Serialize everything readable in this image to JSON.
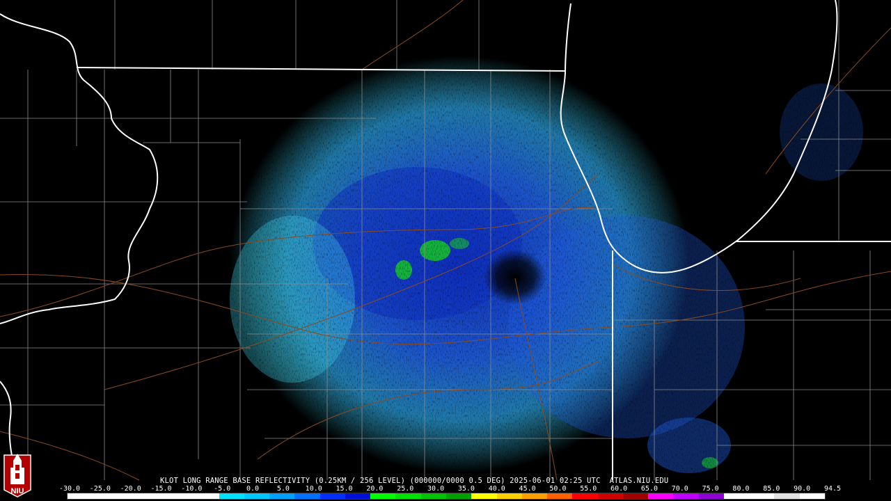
{
  "caption": "KLOT LONG RANGE BASE REFLECTIVITY (0.25KM / 256 LEVEL) (000000/0000 0.5 DEG) 2025-06-01 02:25 UTC  ATLAS.NIU.EDU",
  "logo": {
    "text": "NIU",
    "icon": "university-tower-logo-icon"
  },
  "colors": {
    "background": "#000000",
    "state_border": "#ffffff",
    "county_line": "#8a8a8a",
    "highway": "#8a4a20",
    "light_cyan": "#3fd0e8",
    "blue": "#1f5de0",
    "dark_blue": "#0f2fc0",
    "green": "#18c828"
  },
  "scale": {
    "labels": [
      "-30.0",
      "-25.0",
      "-20.0",
      "-15.0",
      "-10.0",
      "-5.0",
      "0.0",
      "5.0",
      "10.0",
      "15.0",
      "20.0",
      "25.0",
      "30.0",
      "35.0",
      "40.0",
      "45.0",
      "50.0",
      "55.0",
      "60.0",
      "65.0",
      "70.0",
      "75.0",
      "80.0",
      "85.0",
      "90.0",
      "94.5"
    ],
    "colors": [
      "#ffffff",
      "#ffffff",
      "#ffffff",
      "#ffffff",
      "#ffffff",
      "#ffffff",
      "#00e0ff",
      "#00c8ff",
      "#00a0ff",
      "#0070ff",
      "#0030ff",
      "#0010d8",
      "#00ff00",
      "#00e000",
      "#00c000",
      "#00a000",
      "#ffff00",
      "#ffd000",
      "#ffa000",
      "#ff6000",
      "#ff0000",
      "#d00000",
      "#a00000",
      "#ff00ff",
      "#c000ff",
      "#9000d0",
      "#ffffff",
      "#ffffff",
      "#e0e0e0",
      "#ffffff"
    ]
  }
}
